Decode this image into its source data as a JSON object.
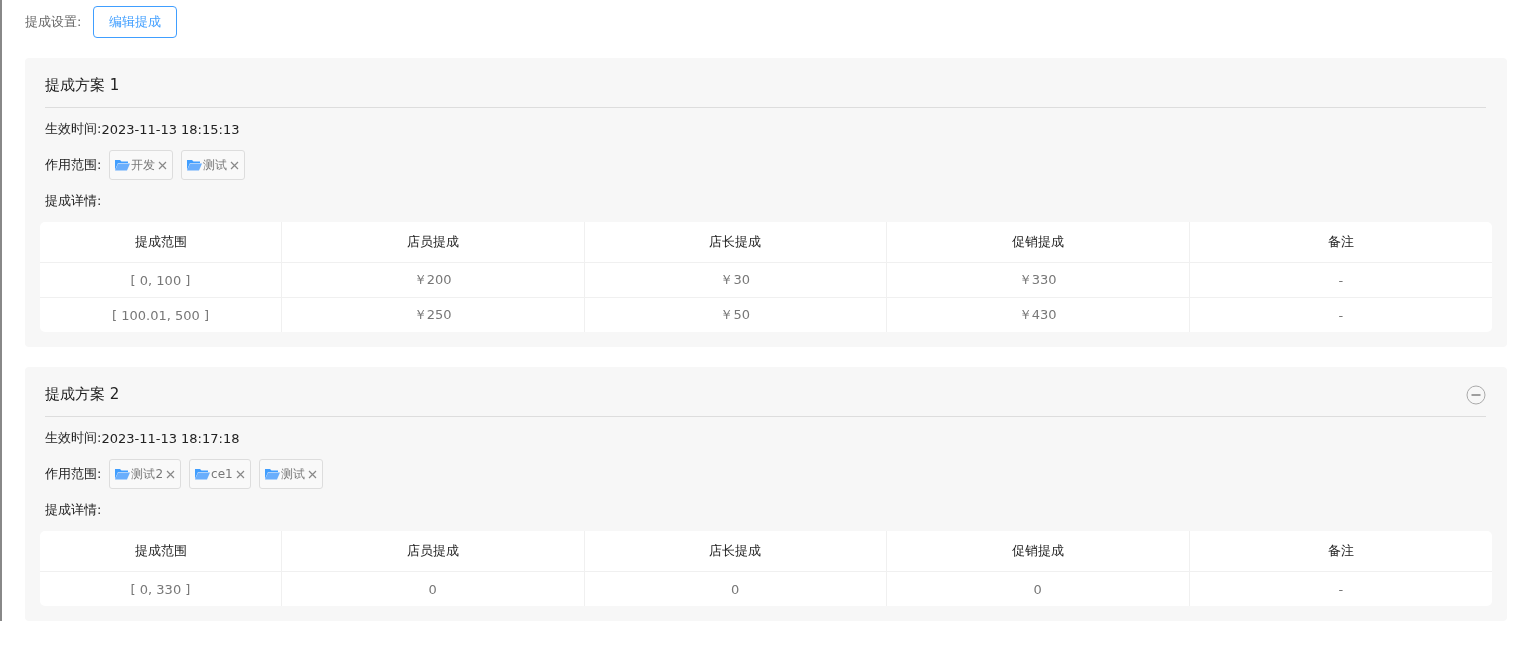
{
  "settings": {
    "label": "提成设置:",
    "edit_button": "编辑提成"
  },
  "plans": [
    {
      "title": "提成方案 1",
      "removable": false,
      "effective_label": "生效时间:",
      "effective_time": "2023-11-13 18:15:13",
      "scope_label": "作用范围:",
      "scope_tags": [
        "开发",
        "测试"
      ],
      "detail_label": "提成详情:",
      "table": {
        "columns": [
          "提成范围",
          "店员提成",
          "店长提成",
          "促销提成",
          "备注"
        ],
        "rows": [
          [
            "[ 0, 100 ]",
            "￥200",
            "￥30",
            "￥330",
            "-"
          ],
          [
            "[ 100.01, 500 ]",
            "￥250",
            "￥50",
            "￥430",
            "-"
          ]
        ]
      }
    },
    {
      "title": "提成方案 2",
      "removable": true,
      "effective_label": "生效时间:",
      "effective_time": "2023-11-13 18:17:18",
      "scope_label": "作用范围:",
      "scope_tags": [
        "测试2",
        "ce1",
        "测试"
      ],
      "detail_label": "提成详情:",
      "table": {
        "columns": [
          "提成范围",
          "店员提成",
          "店长提成",
          "促销提成",
          "备注"
        ],
        "rows": [
          [
            "[ 0, 330 ]",
            "0",
            "0",
            "0",
            "-"
          ]
        ]
      }
    }
  ]
}
